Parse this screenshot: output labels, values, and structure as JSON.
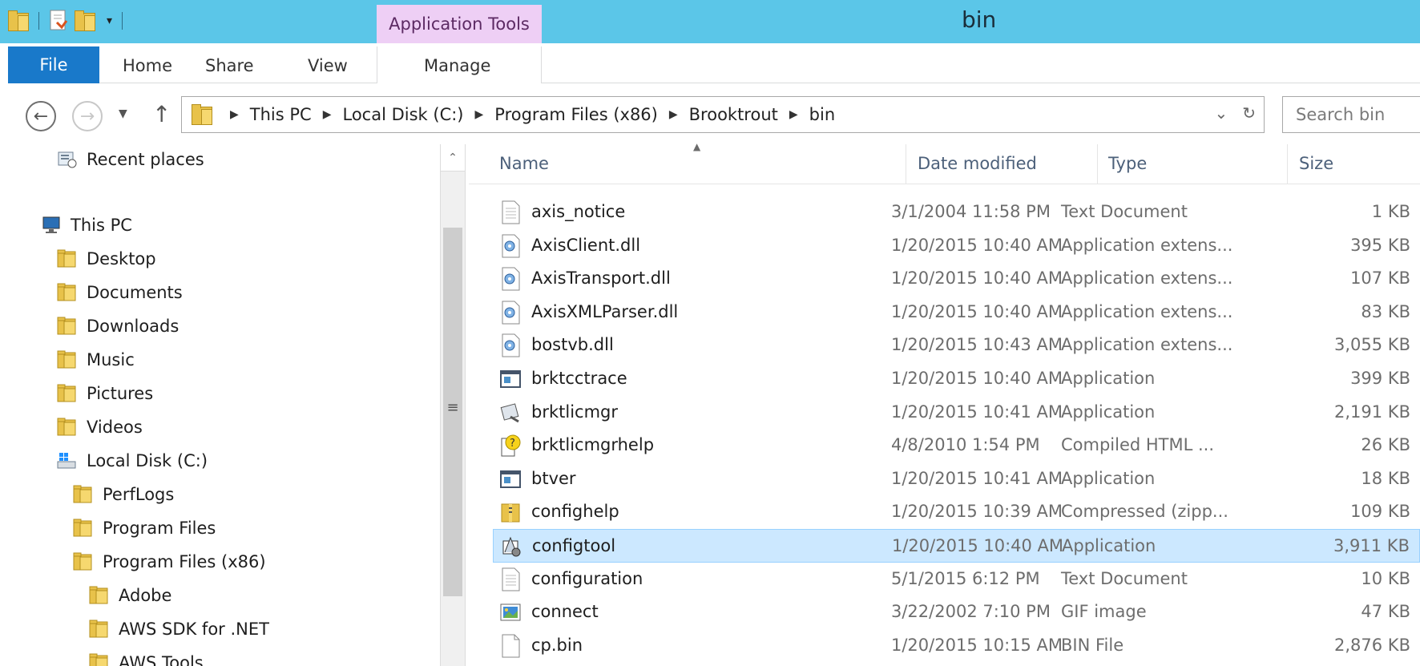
{
  "window": {
    "title": "bin"
  },
  "ribbon": {
    "context_group": "Application Tools",
    "tabs": [
      "File",
      "Home",
      "Share",
      "View"
    ],
    "context_tab": "Manage"
  },
  "address": {
    "crumbs": [
      "This PC",
      "Local Disk (C:)",
      "Program Files (x86)",
      "Brooktrout",
      "bin"
    ],
    "search_placeholder": "Search bin"
  },
  "nav": {
    "items": [
      {
        "label": "Recent places",
        "icon": "recent-places-icon",
        "indent": 0
      },
      {
        "label": "This PC",
        "icon": "computer-icon",
        "indent": 0
      },
      {
        "label": "Desktop",
        "icon": "desktop-folder-icon",
        "indent": 1
      },
      {
        "label": "Documents",
        "icon": "documents-folder-icon",
        "indent": 1
      },
      {
        "label": "Downloads",
        "icon": "downloads-folder-icon",
        "indent": 1
      },
      {
        "label": "Music",
        "icon": "music-folder-icon",
        "indent": 1
      },
      {
        "label": "Pictures",
        "icon": "pictures-folder-icon",
        "indent": 1
      },
      {
        "label": "Videos",
        "icon": "videos-folder-icon",
        "indent": 1
      },
      {
        "label": "Local Disk (C:)",
        "icon": "local-disk-icon",
        "indent": 1
      },
      {
        "label": "PerfLogs",
        "icon": "folder-icon",
        "indent": 2
      },
      {
        "label": "Program Files",
        "icon": "folder-icon",
        "indent": 2
      },
      {
        "label": "Program Files (x86)",
        "icon": "folder-icon",
        "indent": 2
      },
      {
        "label": "Adobe",
        "icon": "folder-icon",
        "indent": 3
      },
      {
        "label": "AWS SDK for .NET",
        "icon": "folder-icon",
        "indent": 3
      },
      {
        "label": "AWS Tools",
        "icon": "folder-icon",
        "indent": 3
      }
    ]
  },
  "columns": {
    "name": "Name",
    "date": "Date modified",
    "type": "Type",
    "size": "Size"
  },
  "files": [
    {
      "name": "axis_notice",
      "date": "3/1/2004 11:58 PM",
      "type": "Text Document",
      "size": "1 KB",
      "icon": "text-file-icon"
    },
    {
      "name": "AxisClient.dll",
      "date": "1/20/2015 10:40 AM",
      "type": "Application extens...",
      "size": "395 KB",
      "icon": "dll-icon"
    },
    {
      "name": "AxisTransport.dll",
      "date": "1/20/2015 10:40 AM",
      "type": "Application extens...",
      "size": "107 KB",
      "icon": "dll-icon"
    },
    {
      "name": "AxisXMLParser.dll",
      "date": "1/20/2015 10:40 AM",
      "type": "Application extens...",
      "size": "83 KB",
      "icon": "dll-icon"
    },
    {
      "name": "bostvb.dll",
      "date": "1/20/2015 10:43 AM",
      "type": "Application extens...",
      "size": "3,055 KB",
      "icon": "dll-icon"
    },
    {
      "name": "brktcctrace",
      "date": "1/20/2015 10:40 AM",
      "type": "Application",
      "size": "399 KB",
      "icon": "exe-icon"
    },
    {
      "name": "brktlicmgr",
      "date": "1/20/2015 10:41 AM",
      "type": "Application",
      "size": "2,191 KB",
      "icon": "license-app-icon"
    },
    {
      "name": "brktlicmgrhelp",
      "date": "4/8/2010 1:54 PM",
      "type": "Compiled HTML ...",
      "size": "26 KB",
      "icon": "chm-help-icon"
    },
    {
      "name": "btver",
      "date": "1/20/2015 10:41 AM",
      "type": "Application",
      "size": "18 KB",
      "icon": "exe-icon"
    },
    {
      "name": "confighelp",
      "date": "1/20/2015 10:39 AM",
      "type": "Compressed (zipp...",
      "size": "109 KB",
      "icon": "zip-folder-icon"
    },
    {
      "name": "configtool",
      "date": "1/20/2015 10:40 AM",
      "type": "Application",
      "size": "3,911 KB",
      "icon": "config-app-icon",
      "selected": true
    },
    {
      "name": "configuration",
      "date": "5/1/2015 6:12 PM",
      "type": "Text Document",
      "size": "10 KB",
      "icon": "text-file-icon"
    },
    {
      "name": "connect",
      "date": "3/22/2002 7:10 PM",
      "type": "GIF image",
      "size": "47 KB",
      "icon": "image-file-icon"
    },
    {
      "name": "cp.bin",
      "date": "1/20/2015 10:15 AM",
      "type": "BIN File",
      "size": "2,876 KB",
      "icon": "blank-file-icon"
    }
  ]
}
